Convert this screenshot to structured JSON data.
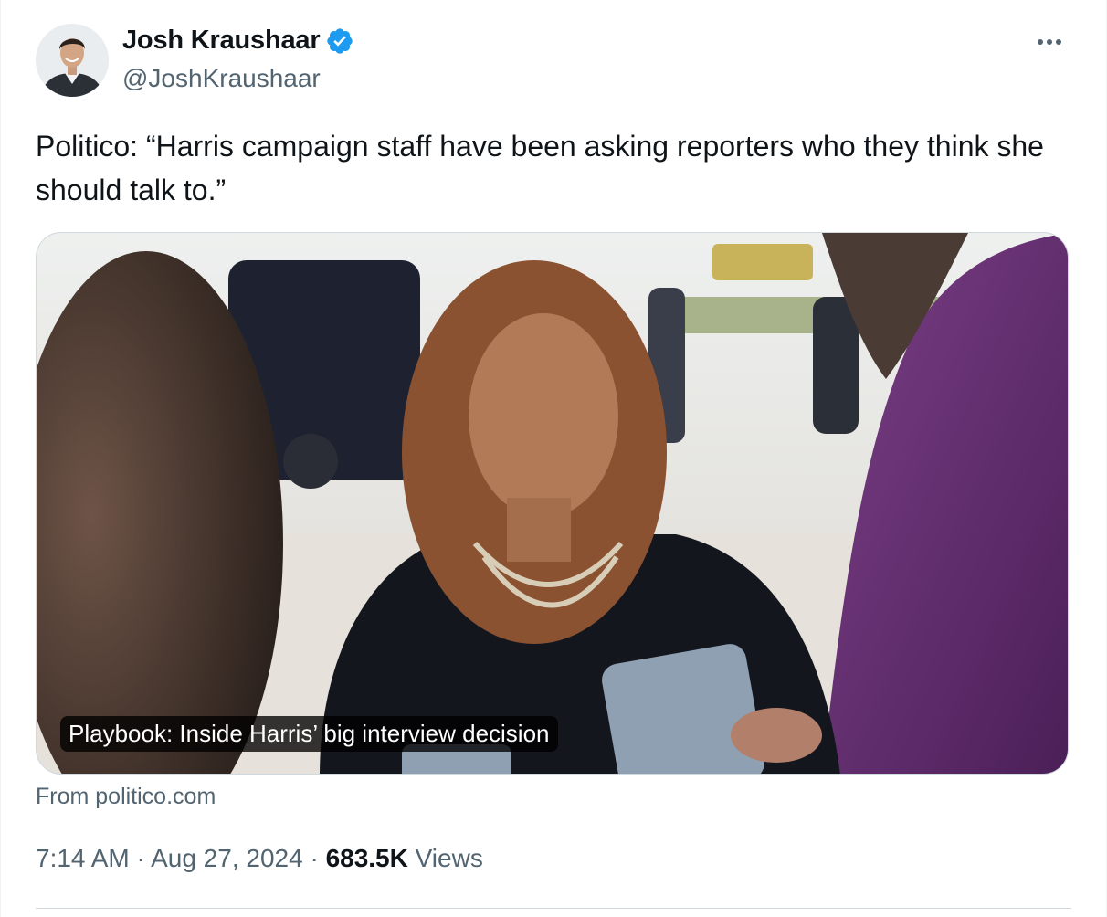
{
  "author": {
    "name": "Josh Kraushaar",
    "handle": "@JoshKraushaar",
    "verified": true,
    "verified_color": "#1d9bf0"
  },
  "tweet": {
    "text": "Politico: “Harris campaign staff have been asking reporters who they think she should talk to.”"
  },
  "link_card": {
    "caption": "Playbook: Inside Harris’ big interview decision",
    "source": "From politico.com"
  },
  "meta": {
    "time": "7:14 AM",
    "separator": " · ",
    "date": "Aug 27, 2024",
    "views_count": "683.5K",
    "views_label": "Views"
  },
  "icons": {
    "more": "more-horizontal-icon",
    "verified": "verified-badge-icon"
  }
}
